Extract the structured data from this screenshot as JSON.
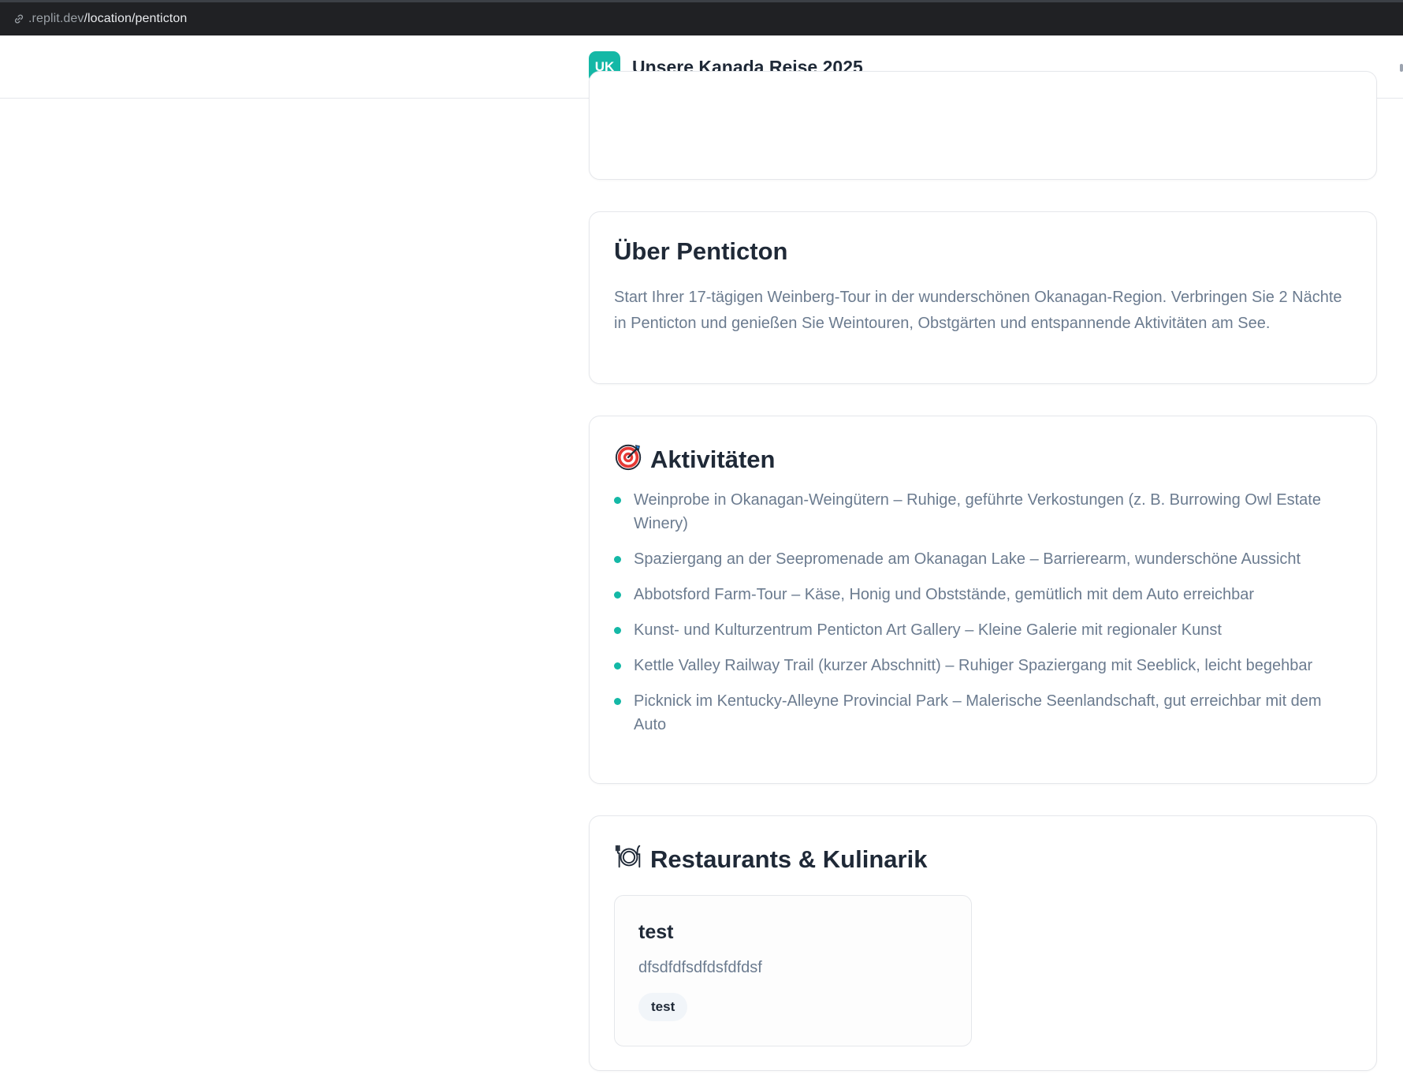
{
  "browser": {
    "url_domain": ".replit.dev",
    "url_path": "/location/penticton"
  },
  "header": {
    "logo_text": "UK",
    "title": "Unsere Kanada Reise 2025"
  },
  "about": {
    "heading": "Über Penticton",
    "text": "Start Ihrer 17-tägigen Weinberg-Tour in der wunderschönen Okanagan-Region. Verbringen Sie 2 Nächte in Penticton und genießen Sie Weintouren, Obstgärten und entspannende Aktivitäten am See."
  },
  "activities": {
    "heading": "Aktivitäten",
    "icon": "target-icon",
    "items": [
      "Weinprobe in Okanagan-Weingütern – Ruhige, geführte Verkostungen (z. B. Burrowing Owl Estate Winery)",
      "Spaziergang an der Seepromenade am Okanagan Lake – Barrierearm, wunderschöne Aussicht",
      "Abbotsford Farm-Tour – Käse, Honig und Obststände, gemütlich mit dem Auto erreichbar",
      "Kunst- und Kulturzentrum Penticton Art Gallery – Kleine Galerie mit regionaler Kunst",
      "Kettle Valley Railway Trail (kurzer Abschnitt) – Ruhiger Spaziergang mit Seeblick, leicht begehbar",
      "Picknick im Kentucky-Alleyne Provincial Park – Malerische Seenlandschaft, gut erreichbar mit dem Auto"
    ]
  },
  "restaurants": {
    "heading": "Restaurants & Kulinarik",
    "icon": "plate-cutlery-icon",
    "items": [
      {
        "name": "test",
        "description": "dfsdfdfsdfdsfdfdsf",
        "tag": "test"
      }
    ]
  },
  "colors": {
    "accent": "#14b8a6",
    "heading": "#1f2937",
    "body_text": "#6b7b8f",
    "border": "#e5e7eb"
  }
}
